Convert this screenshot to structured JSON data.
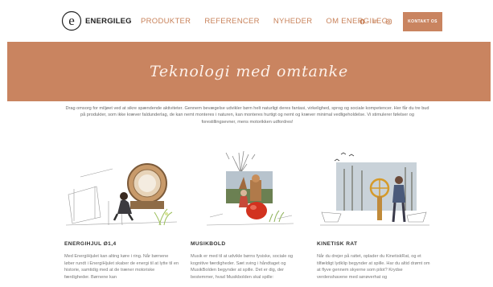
{
  "brand": {
    "name": "ENERGILEG",
    "logo_letter": "e"
  },
  "nav": [
    {
      "label": "PRODUKTER"
    },
    {
      "label": "REFERENCER"
    },
    {
      "label": "NYHEDER"
    },
    {
      "label": "OM ENERGILEG"
    }
  ],
  "socials": [
    {
      "icon": "facebook-icon"
    },
    {
      "icon": "linkedin-icon",
      "label": "in"
    },
    {
      "icon": "instagram-icon"
    }
  ],
  "contact_button": {
    "label": "KONTAKT OS"
  },
  "banner": {
    "title": "Teknologi med omtanke"
  },
  "intro": {
    "text": "Drag omsorg for miljøet ved at sikre spændende aktiviteter. Gennem bevægelse udvikler børn helt naturligt deres fantasi, virkelighed, sprog og sociale kompetencer. Her får du tre bud på produkter, som ikke kræver faldunderlag, de kan nemt monteres i naturen, kan monteres hurtigt og nemt og kræver minimal vedligeholdelse. Vi stimulerer følelser og forestillingsevner, mens motorikken udfordres!"
  },
  "cards": [
    {
      "title": "ENERGIHJUL Ø1,4",
      "text": "Med EnergiHjulet kan alting køre i ring. Når børnene løber rundt i EnergiHjulet skaber de energi til at lytte til en historie, samtidig med at de træner motoriske færdigheder. Børnene kan"
    },
    {
      "title": "MUSIKBOLD",
      "text": "Musik er med til at udvikle børns fysiske, sociale og kognitive færdigheder. Sæt sving i håndtaget og MusikBolden begynder at spille. Det er dig, der bestemmer, hvad Musikbolden skal spille:"
    },
    {
      "title": "KINETISK RAT",
      "text": "Når du drejer på rattet, oplader du KinetiskRat, og et tilfældigt lydklip begynder at spille. Har du altid drømt om at flyve gennem skyerne som pilot? Krydse verdenshavene med sørøverhat og"
    }
  ],
  "colors": {
    "accent": "#c98460",
    "nav": "#c8825a"
  }
}
